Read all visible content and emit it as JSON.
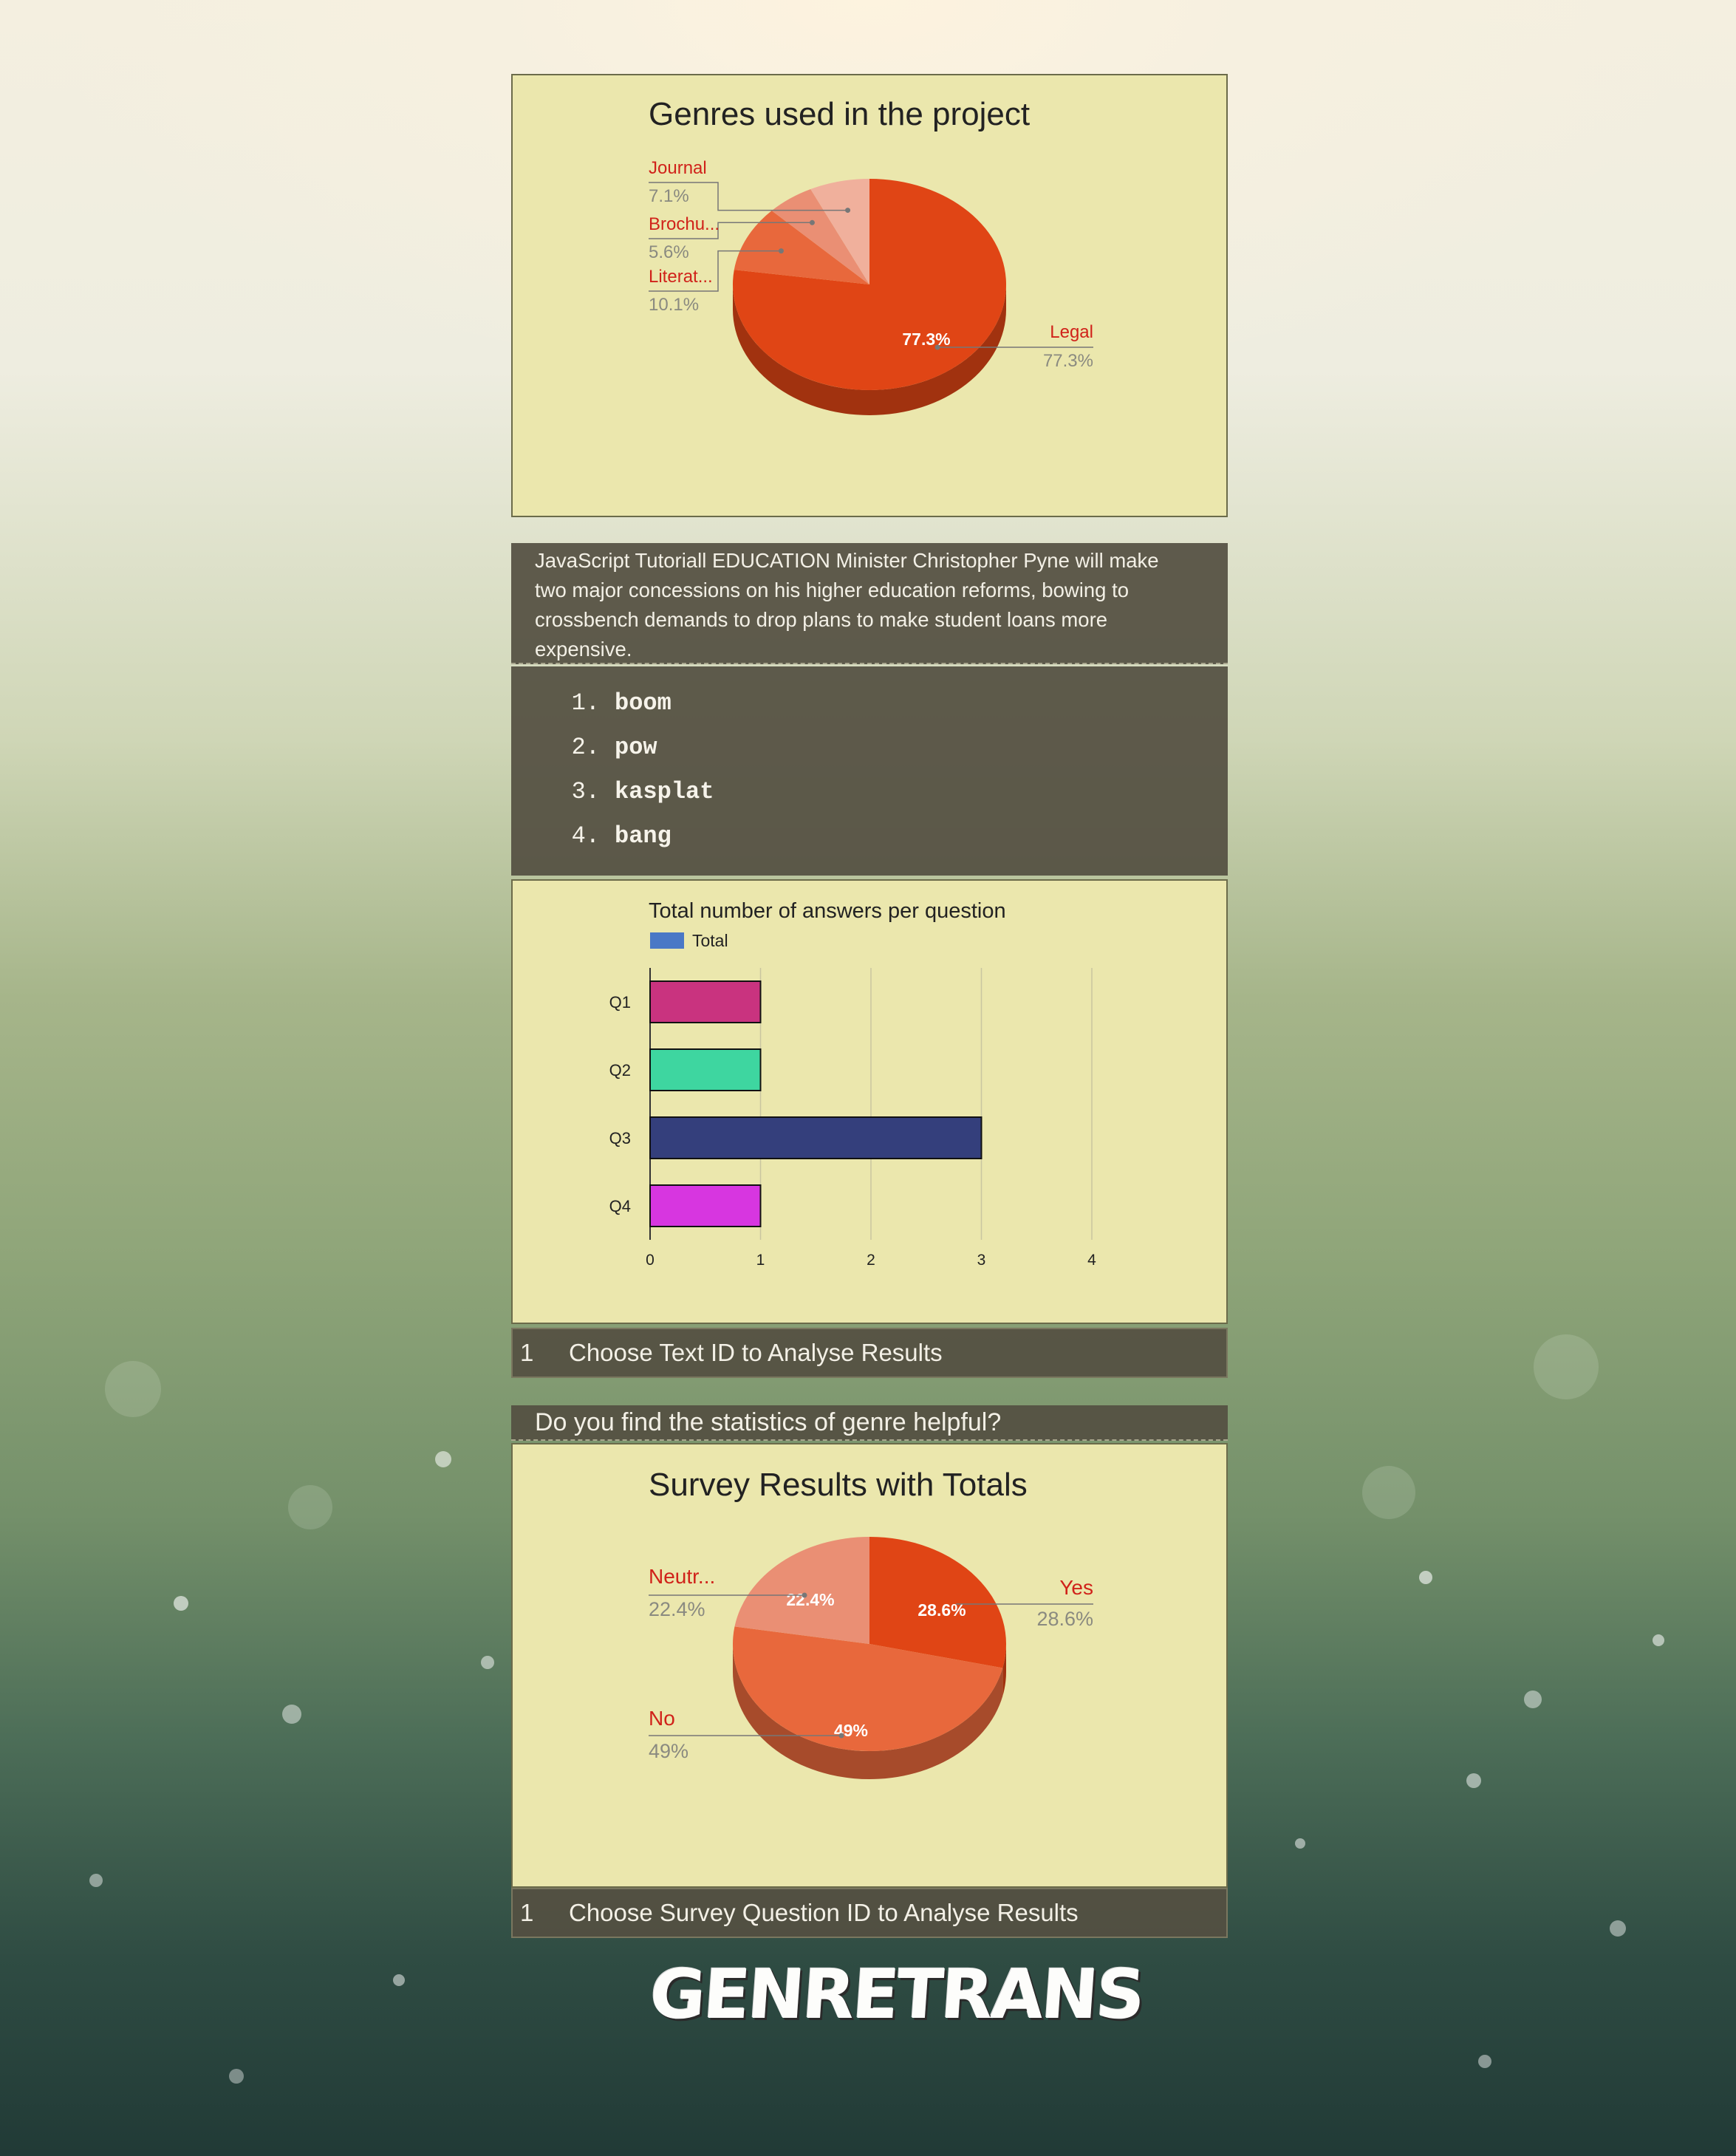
{
  "pie_genres": {
    "title": "Genres used in the project",
    "slices": [
      {
        "label": "Legal",
        "value": 77.3,
        "pct_label": "77.3%",
        "inside_label": "77.3%",
        "color": "#e04515"
      },
      {
        "label": "Literat...",
        "value": 10.1,
        "pct_label": "10.1%",
        "inside_label": "",
        "color": "#e8683c"
      },
      {
        "label": "Brochu...",
        "value": 5.6,
        "pct_label": "5.6%",
        "inside_label": "",
        "color": "#ea8f74"
      },
      {
        "label": "Journal",
        "value": 7.1,
        "pct_label": "7.1%",
        "inside_label": "",
        "color": "#f0b09c"
      }
    ]
  },
  "article": {
    "text": "JavaScript Tutoriall EDUCATION Minister Christopher Pyne will make two major concessions on his higher education reforms, bowing to crossbench demands to drop plans to make student loans more expensive."
  },
  "list": {
    "items": [
      {
        "num": "1.",
        "text": "boom"
      },
      {
        "num": "2.",
        "text": "pow"
      },
      {
        "num": "3.",
        "text": "kasplat"
      },
      {
        "num": "4.",
        "text": "bang"
      }
    ]
  },
  "chart_data": {
    "type": "bar",
    "title": "Total number of answers per question",
    "legend": "Total",
    "legend_color": "#4a78c6",
    "categories": [
      "Q1",
      "Q2",
      "Q3",
      "Q4"
    ],
    "values": [
      1,
      1,
      3,
      1
    ],
    "colors": [
      "#c9337f",
      "#3ed6a0",
      "#343f7c",
      "#d736e0"
    ],
    "xlim": [
      0,
      4
    ],
    "xticks": [
      "0",
      "1",
      "2",
      "3",
      "4"
    ],
    "orientation": "horizontal",
    "grid": true
  },
  "text_selector": {
    "value": "1",
    "label": "Choose Text ID to Analyse Results"
  },
  "question": {
    "text": "Do you find the statistics of genre helpful?"
  },
  "pie_survey": {
    "title": "Survey Results with Totals",
    "slices": [
      {
        "label": "Yes",
        "value": 28.6,
        "pct_label": "28.6%",
        "inside_label": "28.6%",
        "color": "#e04515"
      },
      {
        "label": "No",
        "value": 49,
        "pct_label": "49%",
        "inside_label": "49%",
        "color": "#e8683c"
      },
      {
        "label": "Neutr...",
        "value": 22.4,
        "pct_label": "22.4%",
        "inside_label": "22.4%",
        "color": "#ea8f74"
      }
    ]
  },
  "survey_selector": {
    "value": "1",
    "label": "Choose Survey Question ID to Analyse Results"
  },
  "logo": {
    "text": "GENRETRANS"
  },
  "colors": {
    "label_red": "#d0221a",
    "label_grey": "#8a8a80"
  }
}
